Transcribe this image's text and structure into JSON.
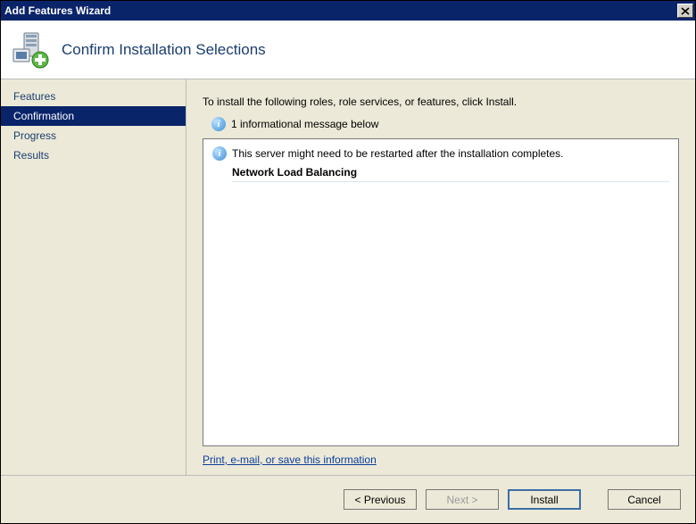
{
  "window": {
    "title": "Add Features Wizard"
  },
  "header": {
    "title": "Confirm Installation Selections"
  },
  "sidebar": {
    "steps": [
      {
        "label": "Features",
        "selected": false
      },
      {
        "label": "Confirmation",
        "selected": true
      },
      {
        "label": "Progress",
        "selected": false
      },
      {
        "label": "Results",
        "selected": false
      }
    ]
  },
  "content": {
    "instruction": "To install the following roles, role services, or features, click Install.",
    "info_count_text": "1 informational message below",
    "restart_warning": "This server might need to be restarted after the installation completes.",
    "features": [
      "Network Load Balancing"
    ],
    "export_link": "Print, e-mail, or save this information"
  },
  "footer": {
    "previous": "< Previous",
    "next": "Next >",
    "install": "Install",
    "cancel": "Cancel"
  }
}
